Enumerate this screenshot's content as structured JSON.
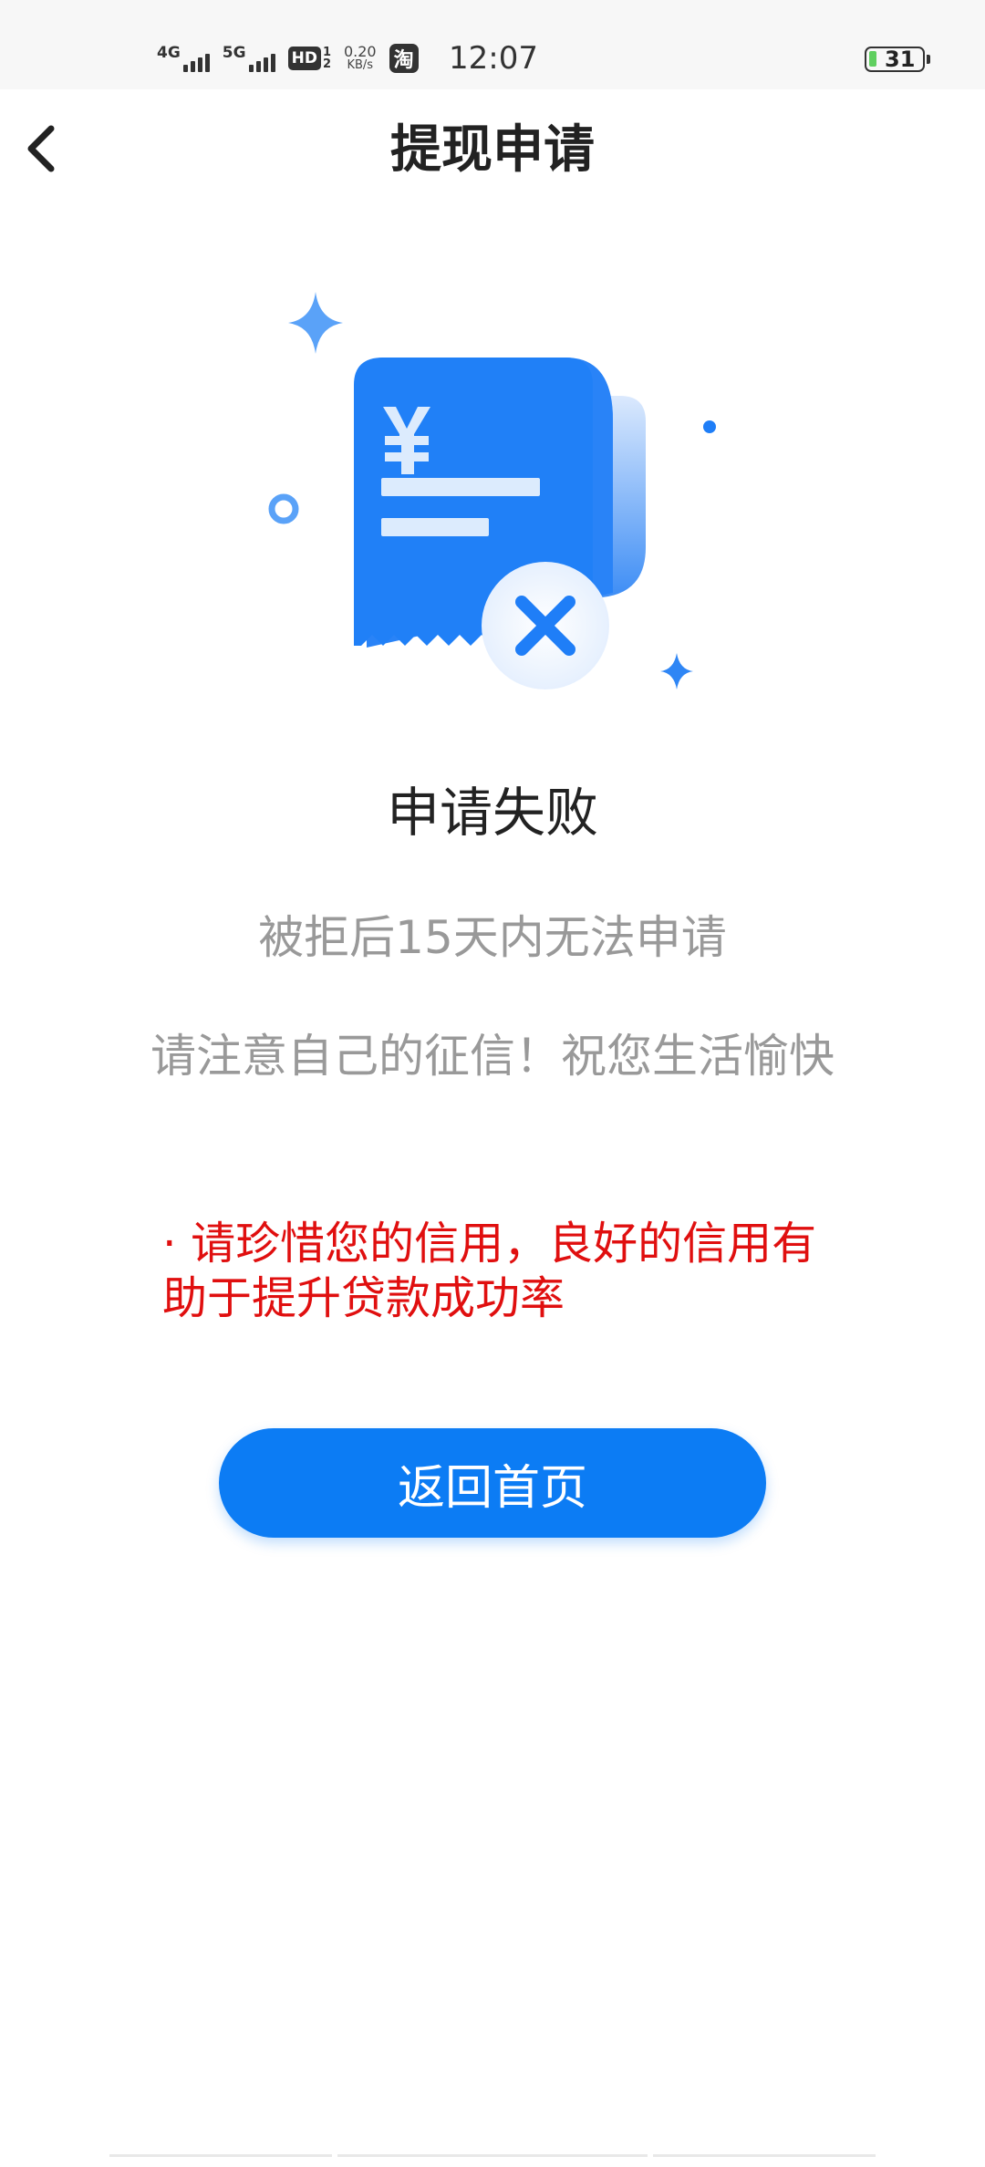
{
  "status_bar": {
    "net_4g": "4G",
    "net_5g": "5G",
    "hd_label": "HD",
    "hd_sub_1": "1",
    "hd_sub_2": "2",
    "speed_value": "0.20",
    "speed_unit": "KB/s",
    "taobao_icon": "淘",
    "time": "12:07",
    "battery_level": "31"
  },
  "nav": {
    "title": "提现申请",
    "back_icon": "chevron-left-icon"
  },
  "result": {
    "icon": "receipt-failed-icon",
    "title": "申请失败",
    "line1": "被拒后15天内无法申请",
    "line2": "请注意自己的征信！祝您生活愉快"
  },
  "warning": {
    "text": "· 请珍惜您的信用，良好的信用有助于提升贷款成功率"
  },
  "actions": {
    "home_button": "返回首页"
  },
  "colors": {
    "primary": "#0c7cf4",
    "warning": "#e00f0f",
    "secondary_text": "#999999",
    "title_text": "#222222"
  }
}
